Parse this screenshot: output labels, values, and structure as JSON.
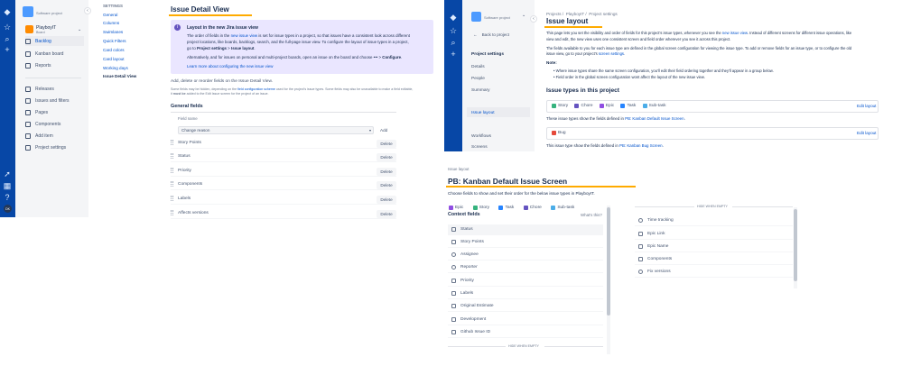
{
  "panel1": {
    "project_type": "Software project",
    "project_name": "PlayboyIT",
    "project_sub": "Board",
    "nav": [
      {
        "label": "Backlog",
        "active": true
      },
      {
        "label": "Kanban board",
        "active": false
      },
      {
        "label": "Reports",
        "active": false
      },
      {
        "label": "Releases",
        "active": false
      },
      {
        "label": "Issues and filters",
        "active": false
      },
      {
        "label": "Pages",
        "active": false
      },
      {
        "label": "Components",
        "active": false
      },
      {
        "label": "Add item",
        "active": false
      },
      {
        "label": "Project settings",
        "active": false
      }
    ],
    "settings_heading": "SETTINGS",
    "settings": [
      "General",
      "Columns",
      "Swimlanes",
      "Quick Filters",
      "Card colors",
      "Card layout",
      "Working days",
      "Issue Detail View"
    ],
    "page_title": "Issue Detail View",
    "info": {
      "title": "Layout in the new Jira issue view",
      "p1_a": "The order of fields in the ",
      "p1_link": "new issue view",
      "p1_b": " is set for issue types in a project, so that issues have a consistent look across different",
      "p1_c": "project locations, like boards, backlogs, search, and the full-page issue view. To configure the layout of issue types in a project,",
      "p1_d": "go to ",
      "p1_bold1": "Project settings",
      "p1_e": " > ",
      "p1_bold2": "Issue layout",
      "p1_f": ".",
      "p2_a": "Alternatively, and for issues on personal and multi-project boards, open an issue on the board and choose ",
      "p2_dots": "•••",
      "p2_b": " > ",
      "p2_bold": "Configure",
      "p2_c": ".",
      "learn_more": "Learn more about configuring the new issue view"
    },
    "add_text": "Add, delete or reorder fields on the Issue Detail View.",
    "note_a": "Some fields may be hidden, depending on the ",
    "note_link": "field configuration scheme",
    "note_b": " used for the project's issue types. Some fields may also be unavailable to make a field editable,",
    "note_c": "it ",
    "note_bold": "must be",
    "note_d": " added to the Edit Issue screen for the project of an issue.",
    "general_fields": "General fields",
    "col_field_name": "Field name",
    "select_value": "Change reason",
    "add_label": "Add",
    "delete_label": "Delete",
    "fields": [
      "Story Points",
      "Status",
      "Priority",
      "Components",
      "Labels",
      "Affects versions"
    ]
  },
  "panel2": {
    "project_type": "Software project",
    "back": "Back to project",
    "settings_title": "Project settings",
    "side": [
      "Details",
      "People",
      "Summary",
      "Issue layout",
      "Workflows",
      "Screens"
    ],
    "breadcrumb": [
      "Projects",
      "PlayboyIT",
      "Project settings"
    ],
    "title": "Issue layout",
    "p1_a": "This page lets you set the visibility and order of fields for this project's issue types, whenever you see the ",
    "p1_link": "new issue view",
    "p1_b": ". Instead of different screens for different issue operations, like",
    "p1_c": "view and edit, the new view uses one consistent screen and field order wherever you see it across this project.",
    "p2_a": "The fields available to you for each issue type are defined in the global screen configuration for viewing the issue type. To add or remove fields for an issue type, or to configure the old",
    "p2_b": "issue view, go to your project's ",
    "p2_link": "screen settings",
    "p2_c": ".",
    "note_label": "Note:",
    "bullets": [
      "Where issue types share the same screen configuration, you'll edit their field ordering together and they'll appear in a group below.",
      "Field order in the global screen configuration wont affect the layout of the new issue view."
    ],
    "types_heading": "Issue types in this project",
    "group1": [
      "Story",
      "Chore",
      "Epic",
      "Task",
      "Sub-task"
    ],
    "edit_layout": "Edit layout",
    "group1_text_a": "These issue types show the fields defined in ",
    "group1_link": "PB: Kanban Default Issue Screen",
    "group1_text_b": ".",
    "group2": [
      "Bug"
    ],
    "group2_text_a": "This issue type show the fields defined in ",
    "group2_link": "PB: Kanban Bug Screen",
    "group2_text_b": "."
  },
  "panel3": {
    "breadcrumb": "Issue layout",
    "title": "PB: Kanban Default Issue Screen",
    "desc": "Choose fields to show and set their order for the below issue types in PlayboyIT.",
    "types": [
      "Epic",
      "Story",
      "Task",
      "Chore",
      "Sub-task"
    ],
    "context_heading": "Context fields",
    "whats_this": "What's this?",
    "context_fields": [
      "Status",
      "Story Points",
      "Assignee",
      "Reporter",
      "Priority",
      "Labels",
      "Original Estimate",
      "Development",
      "Github Issue ID"
    ],
    "hide_when_empty": "HIDE WHEN EMPTY",
    "hidden_fields": [
      "Time tracking",
      "Epic Link",
      "Epic Name",
      "Components",
      "Fix versions"
    ]
  },
  "colors": {
    "rail": "#0747a6",
    "link": "#0052cc",
    "info_bg": "#eae6ff",
    "highlight": "#ffab00",
    "story": "#36b37e",
    "chore": "#6554c0",
    "epic": "#904ee2",
    "task": "#2684ff",
    "subtask": "#4bade8",
    "bug": "#e5493a"
  }
}
